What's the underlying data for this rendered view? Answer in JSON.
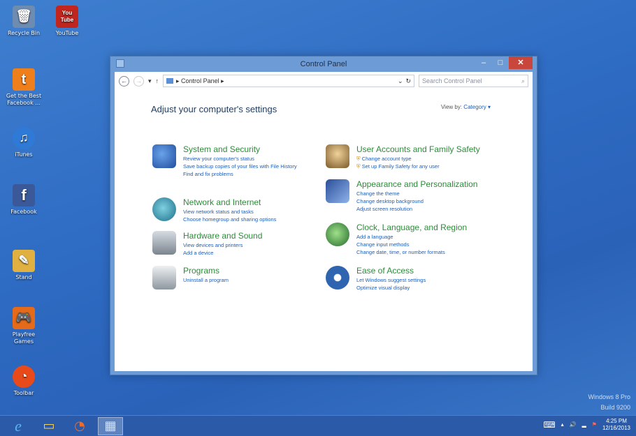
{
  "desktop": {
    "icons": [
      {
        "label": "Recycle Bin",
        "glyph": "🗑",
        "color": "#6e8bb0"
      },
      {
        "label": "YouTube",
        "glyph": "You Tube",
        "color": "#c0261e"
      },
      {
        "label": "Get the Best Facebook ...",
        "glyph": "t",
        "color": "#ef7f1a"
      },
      {
        "label": "iTunes",
        "glyph": "♫",
        "color": "#2f7ad6"
      },
      {
        "label": "Facebook",
        "glyph": "f",
        "color": "#3b5998"
      },
      {
        "label": "Stand",
        "glyph": "✎",
        "color": "#e0b040"
      },
      {
        "label": "Playfree Games",
        "glyph": "🎮",
        "color": "#e56a1a"
      },
      {
        "label": "Toolbar",
        "glyph": "◔",
        "color": "#e94a1a"
      }
    ]
  },
  "window": {
    "title": "Control Panel",
    "min_label": "–",
    "max_label": "□",
    "close_label": "✕"
  },
  "address": {
    "back_glyph": "←",
    "forward_glyph": "→",
    "recent_glyph": "▾",
    "up_glyph": "↑",
    "path": "▸ Control Panel ▸",
    "dropdown_glyph": "⌄",
    "refresh_glyph": "↻",
    "search_placeholder": "Search Control Panel",
    "search_glyph": "⌕"
  },
  "main": {
    "heading": "Adjust your computer's settings",
    "viewby_label": "View by:",
    "viewby_value": "Category ▾",
    "categories": [
      {
        "title": "System and Security",
        "color": "#3b6fc7",
        "links": [
          "Review your computer's status",
          "Save backup copies of your files with File History",
          "Find and fix problems"
        ]
      },
      {
        "title": "Network and Internet",
        "color": "#2c8a9e",
        "links": [
          "View network status and tasks",
          "Choose homegroup and sharing options"
        ]
      },
      {
        "title": "Hardware and Sound",
        "color": "#6f7a84",
        "links": [
          "View devices and printers",
          "Add a device"
        ]
      },
      {
        "title": "Programs",
        "color": "#7f8a93",
        "links": [
          "Uninstall a program"
        ]
      },
      {
        "title": "User Accounts and Family Safety",
        "color": "#b88f4e",
        "links": [
          "Change account type",
          "Set up Family Safety for any user"
        ]
      },
      {
        "title": "Appearance and Personalization",
        "color": "#3a5fae",
        "links": [
          "Change the theme",
          "Change desktop background",
          "Adjust screen resolution"
        ]
      },
      {
        "title": "Clock, Language, and Region",
        "color": "#3a9a4a",
        "links": [
          "Add a language",
          "Change input methods",
          "Change date, time, or number formats"
        ]
      },
      {
        "title": "Ease of Access",
        "color": "#2f65b0",
        "links": [
          "Let Windows suggest settings",
          "Optimize visual display"
        ]
      }
    ]
  },
  "watermark": {
    "line1": "Windows 8 Pro",
    "line2": "Build 9200"
  },
  "taskbar": {
    "ie_glyph": "e",
    "explorer_glyph": "▭",
    "app_glyph": "◔",
    "cp_glyph": "▦",
    "keyboard_glyph": "⌨",
    "arrow_glyph": "▴",
    "volume_glyph": "🔊",
    "network_glyph": "▂",
    "flag_glyph": "⚑",
    "time": "4:25 PM",
    "date": "12/16/2013"
  }
}
